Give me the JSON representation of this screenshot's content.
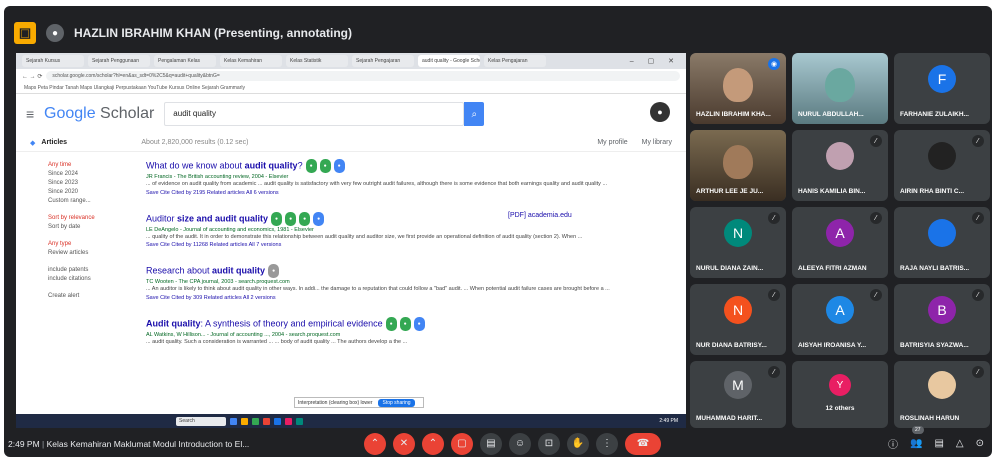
{
  "meeting": {
    "presenter": "HAZLIN IBRAHIM KHAN (Presenting, annotating)",
    "time": "2:49 PM",
    "title": "Kelas Kemahiran Maklumat Modul Introduction to El...",
    "people_count": "27"
  },
  "browser": {
    "tabs": [
      "Sejarah Kursus",
      "Sejarah Penggunaan",
      "Pengalaman Kelas",
      "Kelas Kemahiran",
      "Kelas Statistik",
      "Sejarah Pengajaran",
      "audit quality - Google Scholar",
      "Kelas Pengajaran"
    ],
    "url": "scholar.google.com/scholar?hl=en&as_sdt=0%2C5&q=audit+quality&btnG=",
    "bookmarks": "Maps   Peta   Pindar   Tanah Maps   Ulangkaji   Perpustakaan   YouTube   Kursus Online   Sejarah   Grammarly"
  },
  "scholar": {
    "logo_google": "Google",
    "logo_scholar": "Scholar",
    "query": "audit quality",
    "section": "Articles",
    "result_count": "About 2,820,000 results (0.12 sec)",
    "my_profile": "My profile",
    "my_library": "My library",
    "sidebar": [
      "Any time",
      "Since 2024",
      "Since 2023",
      "Since 2020",
      "Custom range...",
      "",
      "Sort by relevance",
      "Sort by date",
      "",
      "Any type",
      "Review articles",
      "",
      "include patents",
      "include citations",
      "",
      "Create alert"
    ],
    "results": [
      {
        "title_pre": "What do we know about ",
        "title_bold": "audit quality",
        "title_post": "?",
        "meta": "JR Francis - The British accounting review, 2004 - Elsevier",
        "snippet": "... of evidence on audit quality from academic ... audit quality is satisfactory with very few outright audit failures, although there is some evidence that both earnings quality and audit quality ...",
        "actions": "Save   Cite   Cited by 2195   Related articles   All 6 versions",
        "pdf": ""
      },
      {
        "title_pre": "Auditor",
        "title_bold": " size and audit quality",
        "title_post": "",
        "meta": "LE DeAngelo - Journal of accounting and economics, 1981 - Elsevier",
        "snippet": "... quality of the audit. It in order to demonstrate this relationship between audit quality and auditor size, we first provide an operational definition of audit quality (section 2). When ...",
        "actions": "Save   Cite   Cited by 11268   Related articles   All 7 versions",
        "pdf": "[PDF] academia.edu"
      },
      {
        "title_pre": "Research about ",
        "title_bold": "audit quality",
        "title_post": "",
        "meta": "TC Wooten - The CPA journal, 2003 - search.proquest.com",
        "snippet": "... An auditor is likely to think about audit quality in other ways. In addi... the damage to a reputation that could follow a \"bad\" audit. ... When potential audit failure cases are brought before a ...",
        "actions": "Save   Cite   Cited by 309   Related articles   All 2 versions",
        "pdf": ""
      },
      {
        "title_pre": "",
        "title_bold": "Audit quality",
        "title_post": ": A synthesis of theory and empirical evidence",
        "meta": "AL Watkins, W Hillison... - Journal of accounting ..., 2004 - search.proquest.com",
        "snippet": "... audit quality. Such a consideration is warranted ... ... body of audit quality ... The authors develop a the ...",
        "actions": "",
        "pdf": ""
      }
    ],
    "popup_text": "Interpretation (clearing box) lower",
    "popup_btn": "Stop sharing"
  },
  "taskbar": {
    "search": "Search",
    "clock": "2:49 PM"
  },
  "participants": [
    {
      "name": "HAZLIN IBRAHIM KHA...",
      "initial": "",
      "color": "#6b5a4a"
    },
    {
      "name": "NURUL ABDULLAH...",
      "initial": "",
      "color": "#7aa0b0"
    },
    {
      "name": "FARHANIE ZULAIKH...",
      "initial": "F",
      "color": "#1a73e8"
    },
    {
      "name": "ARTHUR LEE JE JU...",
      "initial": "",
      "color": "#5a4a3a"
    },
    {
      "name": "HANIS KAMILIA BIN...",
      "initial": "",
      "color": "#c0a0b0"
    },
    {
      "name": "AIRIN RHA BINTI C...",
      "initial": "",
      "color": "#222222"
    },
    {
      "name": "NURUL DIANA ZAIN...",
      "initial": "N",
      "color": "#00897b"
    },
    {
      "name": "ALEEYA FITRI AZMAN",
      "initial": "A",
      "color": "#8e24aa"
    },
    {
      "name": "RAJA NAYLI BATRIS...",
      "initial": "",
      "color": "#1a73e8"
    },
    {
      "name": "NUR DIANA BATRISY...",
      "initial": "N",
      "color": "#f4511e"
    },
    {
      "name": "AISYAH IROANISA Y...",
      "initial": "A",
      "color": "#1e88e5"
    },
    {
      "name": "BATRISYIA SYAZWA...",
      "initial": "B",
      "color": "#8e24aa"
    },
    {
      "name": "MUHAMMAD HARIT...",
      "initial": "M",
      "color": "#5f6368"
    },
    {
      "name": "12 others",
      "initial": "",
      "color": "#e91e63"
    },
    {
      "name": "ROSLINAH HARUN",
      "initial": "",
      "color": "#e8c8a0"
    }
  ]
}
